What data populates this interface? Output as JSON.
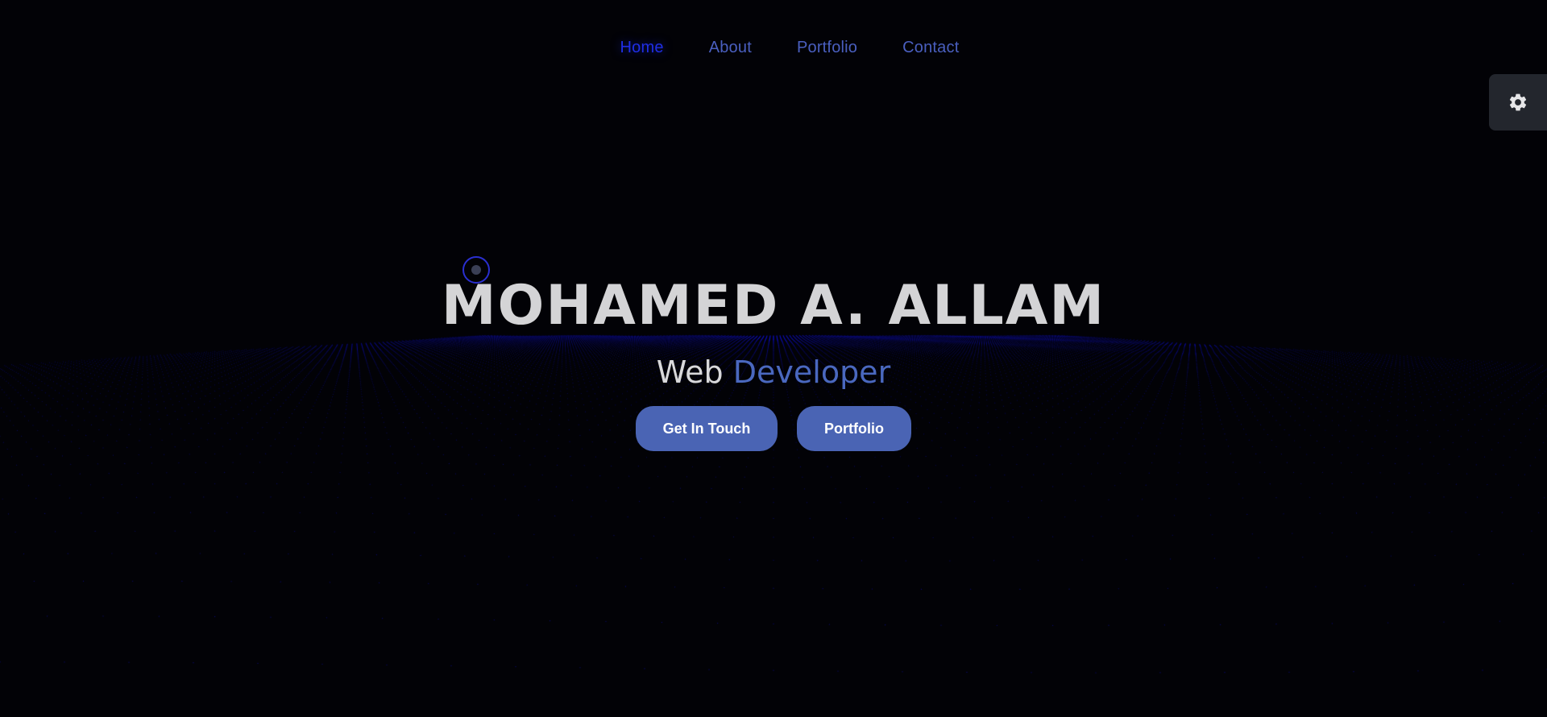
{
  "nav": {
    "items": [
      {
        "label": "Home",
        "active": true
      },
      {
        "label": "About",
        "active": false
      },
      {
        "label": "Portfolio",
        "active": false
      },
      {
        "label": "Contact",
        "active": false
      }
    ]
  },
  "settings": {
    "icon": "gear-icon"
  },
  "hero": {
    "name": "MOHAMED A. ALLAM",
    "role_prefix": "Web",
    "role_accent": "Developer",
    "buttons": {
      "primary": "Get In Touch",
      "secondary": "Portfolio"
    }
  },
  "colors": {
    "background": "#020206",
    "dot": "#1a1aff",
    "nav_link": "#4a5fbf",
    "nav_active": "#1f2ee6",
    "accent": "#4a68bf",
    "button": "#4a64b4",
    "settings_bg": "#23262d"
  }
}
